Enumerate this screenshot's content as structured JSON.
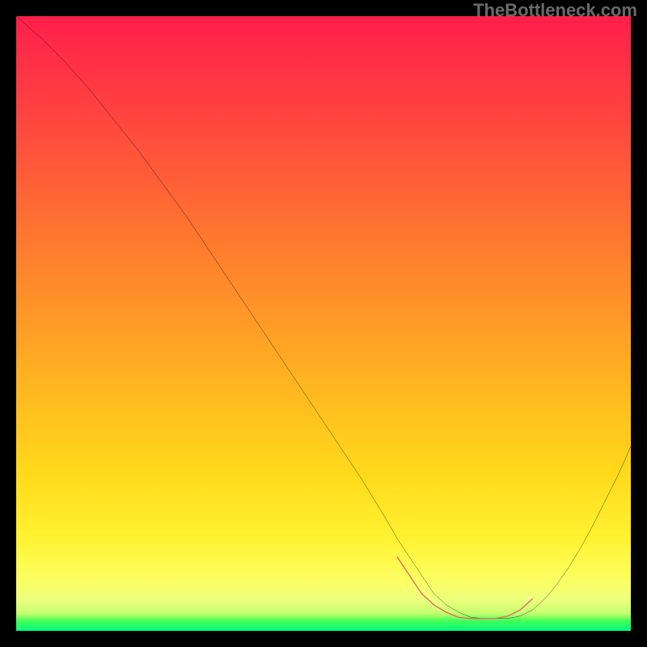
{
  "watermark": "TheBottleneck.com",
  "chart_data": {
    "type": "line",
    "title": "",
    "xlabel": "",
    "ylabel": "",
    "xlim": [
      0,
      100
    ],
    "ylim": [
      0,
      100
    ],
    "series": [
      {
        "name": "curve",
        "x": [
          0,
          4,
          8,
          12,
          16,
          20,
          24,
          28,
          32,
          36,
          40,
          44,
          48,
          52,
          56,
          60,
          62,
          64,
          66,
          68,
          70,
          72,
          74,
          76,
          78,
          80,
          82,
          84,
          86,
          88,
          90,
          92,
          94,
          96,
          98,
          100
        ],
        "values": [
          100,
          96.5,
          92.5,
          88.0,
          83.0,
          78.0,
          72.5,
          67.0,
          61.0,
          55.0,
          49.0,
          43.0,
          37.0,
          31.0,
          25.0,
          18.5,
          15.0,
          12.0,
          9.0,
          6.0,
          4.2,
          3.0,
          2.2,
          2.0,
          2.0,
          2.0,
          2.4,
          3.4,
          5.2,
          7.6,
          10.5,
          13.8,
          17.5,
          21.5,
          25.5,
          30.0
        ]
      }
    ],
    "valley_marker": {
      "name": "valley-highlight",
      "color": "#e86a63",
      "x": [
        62,
        64,
        66,
        68,
        70,
        72,
        74,
        76,
        78,
        80,
        82,
        84
      ],
      "values": [
        12.0,
        9.0,
        6.0,
        4.2,
        3.0,
        2.2,
        2.0,
        2.0,
        2.0,
        2.4,
        3.4,
        5.2
      ]
    }
  }
}
